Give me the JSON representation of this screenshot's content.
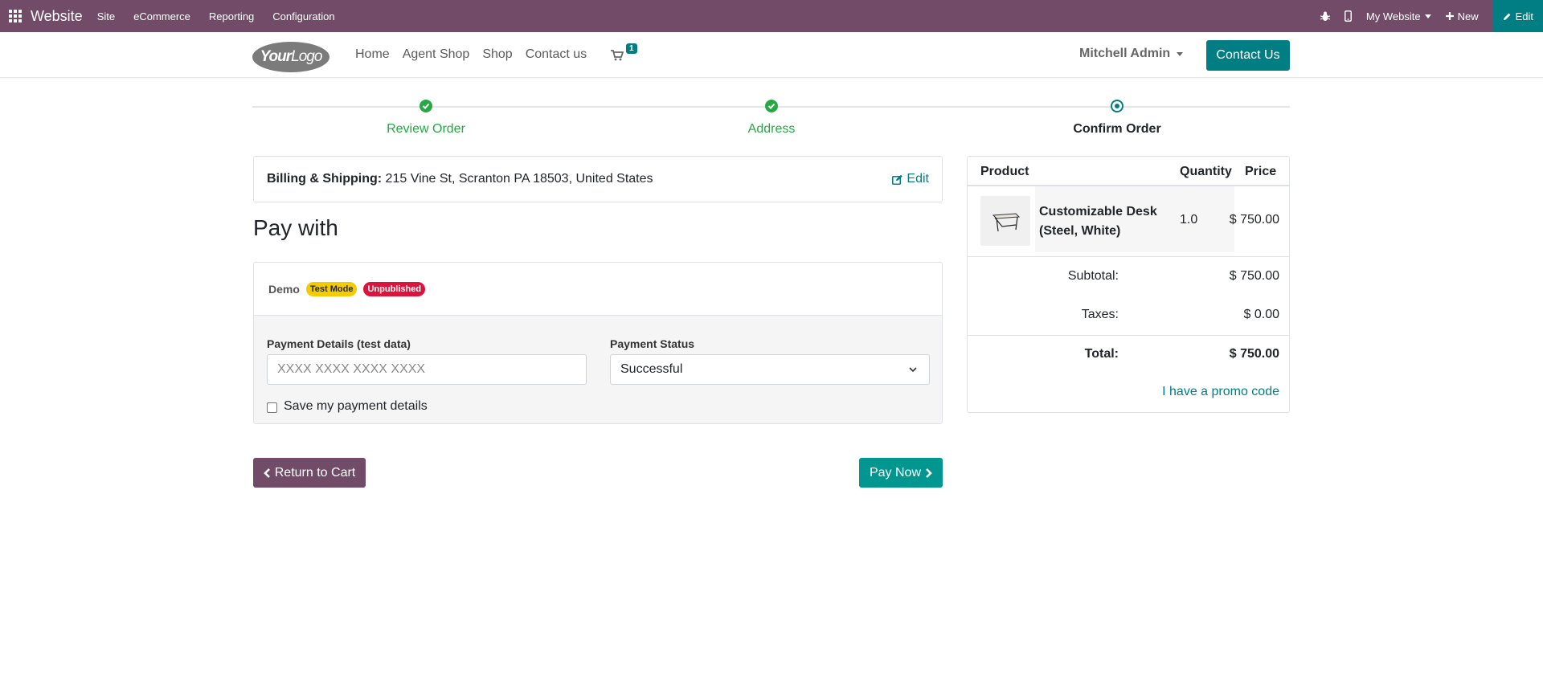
{
  "adminbar": {
    "brand": "Website",
    "menus": [
      "Site",
      "eCommerce",
      "Reporting",
      "Configuration"
    ],
    "website_selector": "My Website",
    "new_label": "New",
    "edit_label": "Edit",
    "color": "#714B67"
  },
  "header": {
    "logo_text_bold": "Your",
    "logo_text": "Logo",
    "nav": [
      "Home",
      "Agent Shop",
      "Shop",
      "Contact us"
    ],
    "cart_count": "1",
    "user": "Mitchell Admin",
    "contact_button": "Contact Us"
  },
  "progress": {
    "steps": [
      {
        "label": "Review Order",
        "state": "done"
      },
      {
        "label": "Address",
        "state": "done"
      },
      {
        "label": "Confirm Order",
        "state": "active"
      }
    ]
  },
  "billing": {
    "label": "Billing & Shipping:",
    "address": "215 Vine St, Scranton PA 18503, United States",
    "edit": "Edit"
  },
  "payment": {
    "title": "Pay with",
    "provider": "Demo",
    "badges": {
      "test": "Test Mode",
      "unpublished": "Unpublished"
    },
    "details_label": "Payment Details (test data)",
    "details_placeholder": "XXXX XXXX XXXX XXXX",
    "status_label": "Payment Status",
    "status_value": "Successful",
    "save_label": "Save my payment details"
  },
  "actions": {
    "return": "Return to Cart",
    "pay": "Pay Now"
  },
  "summary": {
    "headers": {
      "product": "Product",
      "quantity": "Quantity",
      "price": "Price"
    },
    "items": [
      {
        "name": "Customizable Desk (Steel, White)",
        "quantity": "1.0",
        "price": "$ 750.00"
      }
    ],
    "subtotal_label": "Subtotal:",
    "subtotal": "$ 750.00",
    "taxes_label": "Taxes:",
    "taxes": "$ 0.00",
    "total_label": "Total:",
    "total": "$ 750.00",
    "promo": "I have a promo code"
  },
  "colors": {
    "primary": "#017E84",
    "success": "#28a745",
    "admin": "#714B67"
  }
}
